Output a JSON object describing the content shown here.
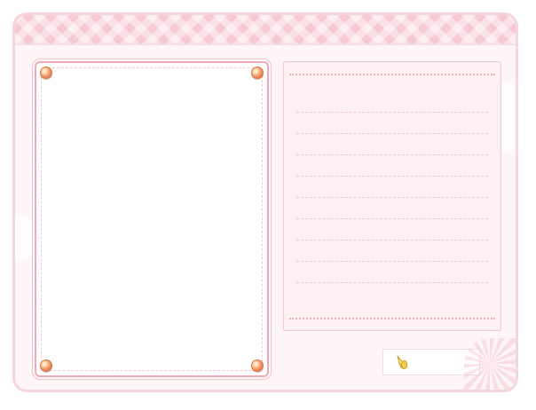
{
  "page": {
    "title": ""
  },
  "photo_frame": {
    "pin_icon": "pushpin-icon"
  },
  "note_card": {
    "line_count": 9
  },
  "cursor_slot": {
    "icon": "mouse-cursor-icon"
  },
  "colors": {
    "accent": "#f7c9d3",
    "frame_bg": "#fdf5f6",
    "pin": "#f29a66",
    "cursor": "#f7d35a"
  }
}
